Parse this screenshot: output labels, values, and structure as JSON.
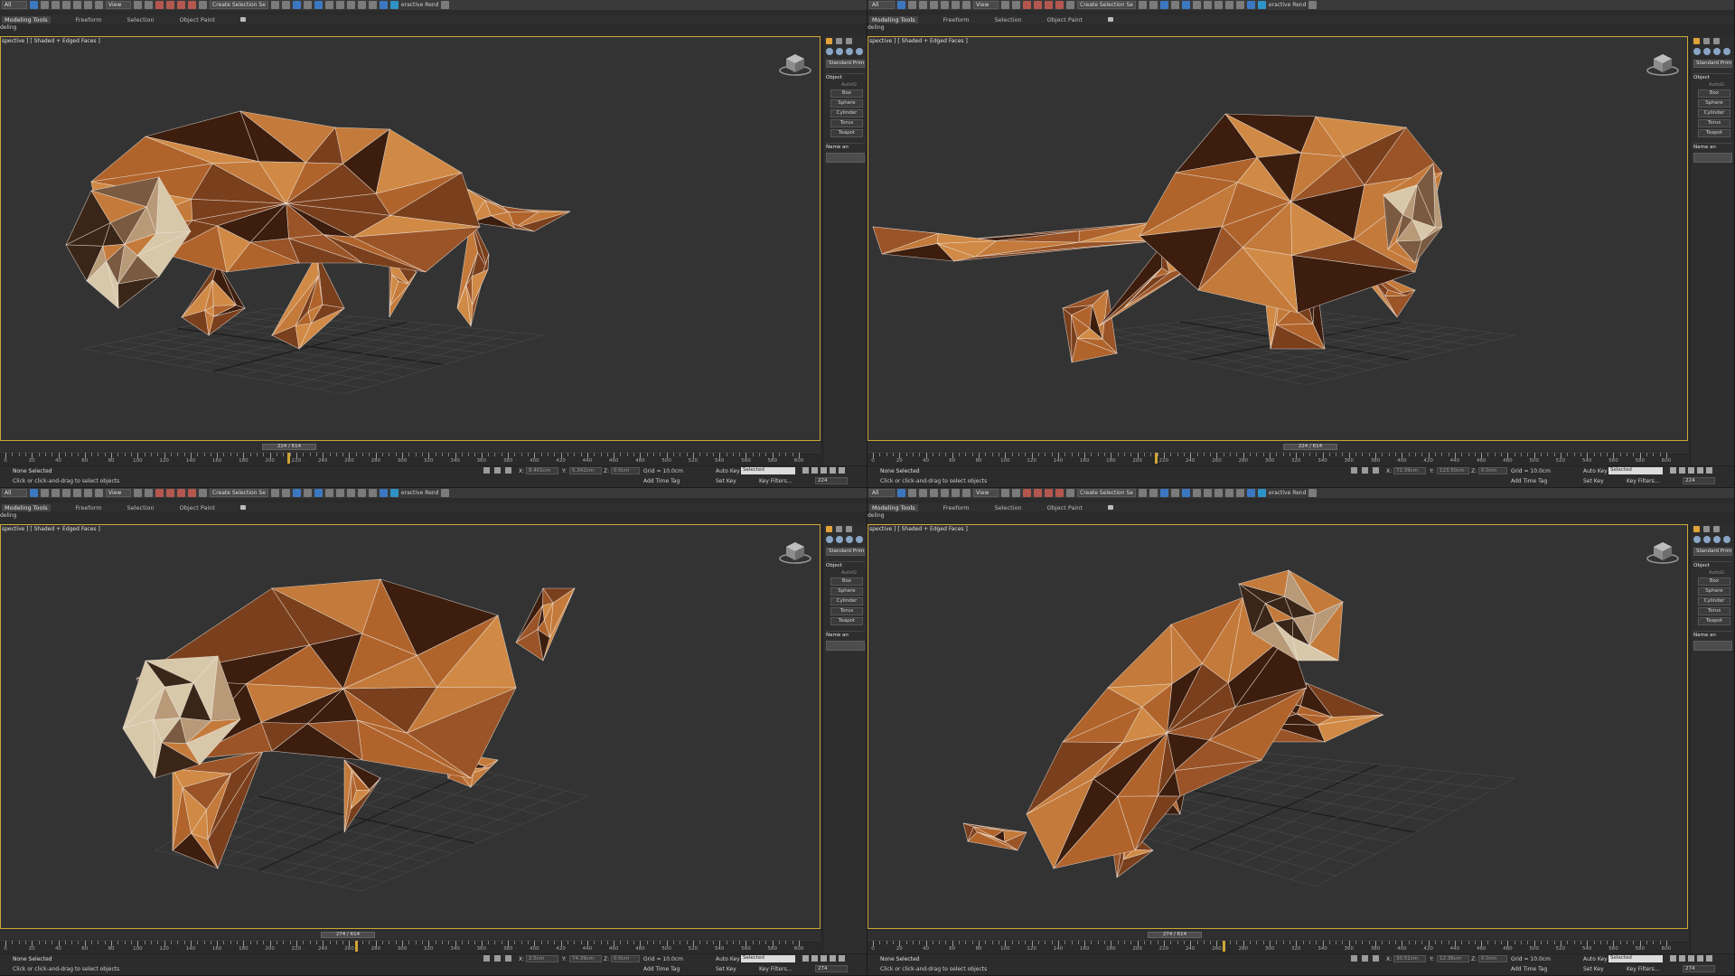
{
  "panes": [
    {
      "viewport_label": "spective ] [ Shaded + Edged Faces ]",
      "frame_slider": "224 / 614",
      "frame_field": "224",
      "coord_x": "8.401cm",
      "coord_y": "5.342cm",
      "coord_z": "0.0cm"
    },
    {
      "viewport_label": "spective ] [ Shaded + Edged Faces ]",
      "frame_slider": "224 / 614",
      "frame_field": "224",
      "coord_x": "72.39cm",
      "coord_y": "123.50cm",
      "coord_z": "0.0cm"
    },
    {
      "viewport_label": "spective ] [ Shaded + Edged Faces ]",
      "frame_slider": "274 / 614",
      "frame_field": "274",
      "coord_x": "2.5cm",
      "coord_y": "74.39cm",
      "coord_z": "0.0cm"
    },
    {
      "viewport_label": "spective ] [ Shaded + Edged Faces ]",
      "frame_slider": "274 / 614",
      "frame_field": "274",
      "coord_x": "30.51cm",
      "coord_y": "12.36cm",
      "coord_z": "0.0cm"
    }
  ],
  "toolbar": {
    "select_filter": "All",
    "view_dropdown": "View",
    "selection_set": "Create Selection Se",
    "interactive_render": "eractive Rend"
  },
  "ribbon": {
    "tabs": [
      "Modeling Tools",
      "Freeform",
      "Selection",
      "Object Paint"
    ],
    "subline": "deling"
  },
  "command_panel": {
    "primitive_type": "Standard Primitives",
    "rollout_object": "Object",
    "autogrid": "AutoG",
    "buttons": [
      "Box",
      "Sphere",
      "Cylinder",
      "Torus",
      "Teapot"
    ],
    "rollout_name": "Name an"
  },
  "timeline": {
    "ticks": [
      "0",
      "20",
      "40",
      "60",
      "80",
      "100",
      "120",
      "140",
      "160",
      "180",
      "200",
      "220",
      "240",
      "260",
      "280",
      "300",
      "320",
      "340",
      "360",
      "380",
      "400",
      "420",
      "440",
      "460",
      "480",
      "500",
      "520",
      "540",
      "560",
      "580",
      "600"
    ]
  },
  "status": {
    "selection": "None Selected",
    "prompt": "Click or click-and-drag to select objects",
    "x_label": "X:",
    "y_label": "Y:",
    "z_label": "Z:",
    "grid": "Grid = 10.0cm",
    "add_time_tag": "Add Time Tag",
    "auto_key": "Auto Key",
    "set_key": "Set Key",
    "selected": "Selected",
    "key_filters": "Key Filters..."
  },
  "colors": {
    "viewport_bg": "#333333",
    "viewport_border": "#c9a93b",
    "mesh_light": "#c47a3a",
    "mesh_mid": "#9a5427",
    "mesh_dark": "#3c1d0e",
    "mesh_face": "#d8c8aa",
    "wire": "#f0e6dc"
  }
}
